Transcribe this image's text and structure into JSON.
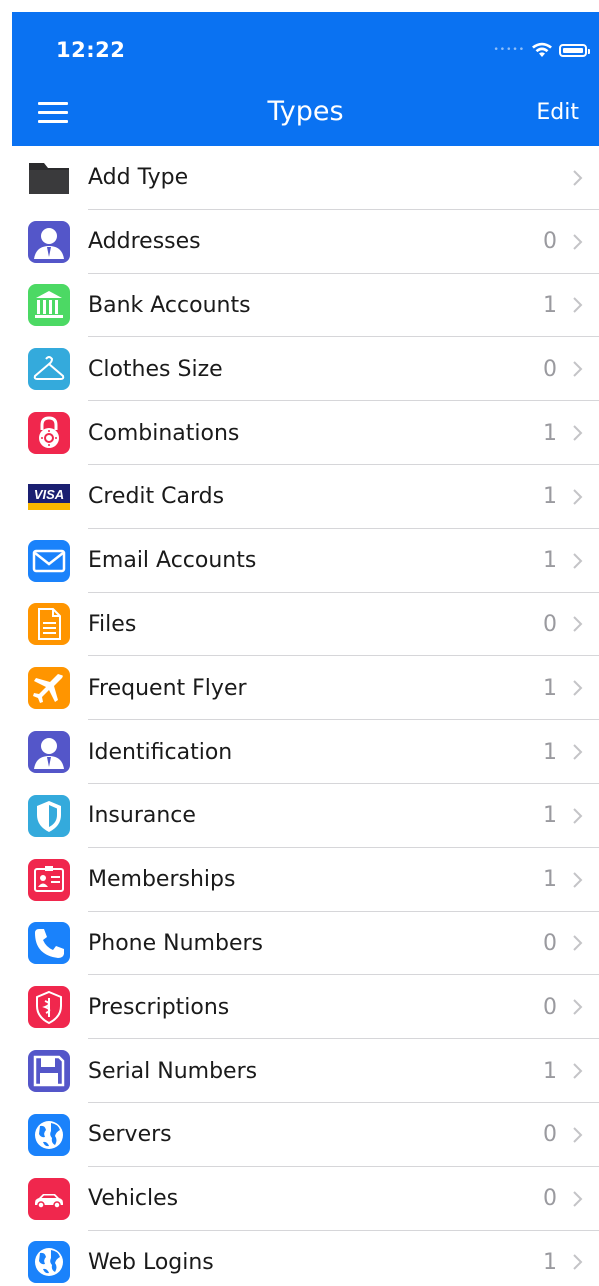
{
  "status_bar": {
    "time": "12:22"
  },
  "nav": {
    "title": "Types",
    "edit_label": "Edit"
  },
  "colors": {
    "header": "#0a72f2",
    "separator": "#d6d6d9",
    "count": "#9a9a9f"
  },
  "items": [
    {
      "label": "Add Type",
      "count": "",
      "icon": "folder-icon"
    },
    {
      "label": "Addresses",
      "count": "0",
      "icon": "person-icon"
    },
    {
      "label": "Bank Accounts",
      "count": "1",
      "icon": "bank-icon"
    },
    {
      "label": "Clothes Size",
      "count": "0",
      "icon": "hanger-icon"
    },
    {
      "label": "Combinations",
      "count": "1",
      "icon": "padlock-icon"
    },
    {
      "label": "Credit Cards",
      "count": "1",
      "icon": "visa-card-icon"
    },
    {
      "label": "Email Accounts",
      "count": "1",
      "icon": "envelope-icon"
    },
    {
      "label": "Files",
      "count": "0",
      "icon": "document-icon"
    },
    {
      "label": "Frequent Flyer",
      "count": "1",
      "icon": "airplane-icon"
    },
    {
      "label": "Identification",
      "count": "1",
      "icon": "person-icon"
    },
    {
      "label": "Insurance",
      "count": "1",
      "icon": "shield-icon"
    },
    {
      "label": "Memberships",
      "count": "1",
      "icon": "id-card-icon"
    },
    {
      "label": "Phone Numbers",
      "count": "0",
      "icon": "phone-icon"
    },
    {
      "label": "Prescriptions",
      "count": "0",
      "icon": "caduceus-shield-icon"
    },
    {
      "label": "Serial Numbers",
      "count": "1",
      "icon": "floppy-disk-icon"
    },
    {
      "label": "Servers",
      "count": "0",
      "icon": "globe-icon"
    },
    {
      "label": "Vehicles",
      "count": "0",
      "icon": "car-icon"
    },
    {
      "label": "Web Logins",
      "count": "1",
      "icon": "globe-icon"
    }
  ]
}
